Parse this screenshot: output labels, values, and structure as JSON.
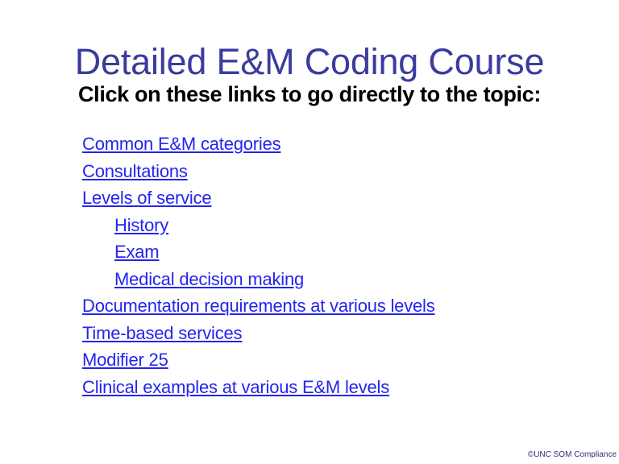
{
  "slide": {
    "title": "Detailed E&M Coding Course",
    "subtitle": "Click on these links to go directly to the topic:",
    "background_color": "#ffffff",
    "title_color": "#3b3b9e",
    "subtitle_color": "#000000",
    "link_color": "#2424f0",
    "footer_color": "#2f2f7a"
  },
  "links": [
    {
      "label": "Common E&M categories",
      "indent": 0
    },
    {
      "label": "Consultations",
      "indent": 0
    },
    {
      "label": "Levels of service",
      "indent": 0
    },
    {
      "label": "History",
      "indent": 1
    },
    {
      "label": "Exam",
      "indent": 1
    },
    {
      "label": "Medical decision making",
      "indent": 1
    },
    {
      "label": "Documentation requirements at various levels",
      "indent": 0
    },
    {
      "label": "Time-based services",
      "indent": 0
    },
    {
      "label": "Modifier 25",
      "indent": 0
    },
    {
      "label": "Clinical examples at various E&M levels",
      "indent": 0
    }
  ],
  "footer": {
    "credit": "©UNC SOM Compliance"
  }
}
